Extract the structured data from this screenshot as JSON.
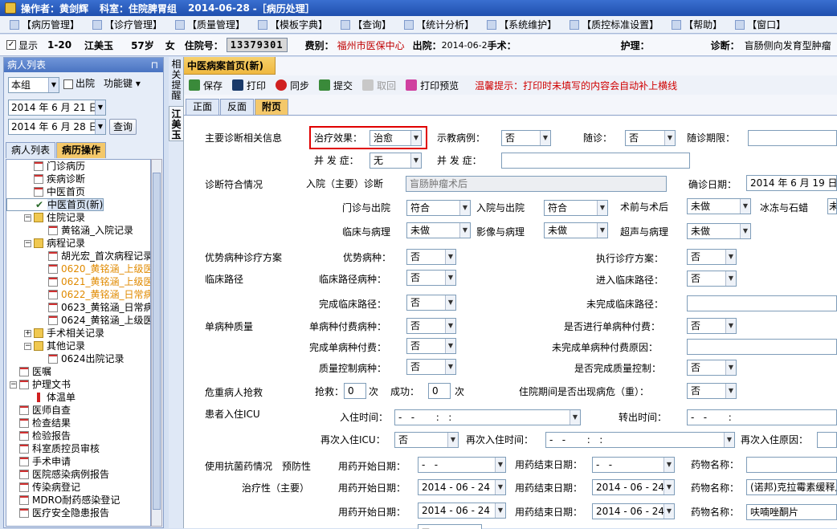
{
  "titlebar": {
    "operator_label": "操作者：黄剑辉",
    "dept_label": "科室：住院脾胃组",
    "date": "2014-06-28",
    "module": "-［病历处理］"
  },
  "menu": [
    "【病历管理】",
    "【诊疗管理】",
    "【质量管理】",
    "【模板字典】",
    "【查询】",
    "【统计分析】",
    "【系统维护】",
    "【质控标准设置】",
    "【帮助】",
    "【窗口】"
  ],
  "infobar": {
    "display_label": "显示",
    "range": "1-20",
    "patient_name": "江美玉",
    "age": "57岁",
    "sex": "女",
    "inpatient_label": "住院号：",
    "inpatient_no": "13379301",
    "fee_label": "费别：",
    "fee_value": "福州市医保中心",
    "discharge_label": "出院：",
    "discharge_value": "2014-06-2",
    "surgery_label": "手术：",
    "nursing_label": "护理：",
    "diagnosis_label": "诊断：",
    "diagnosis_value": "盲肠侧向发育型肿瘤"
  },
  "left": {
    "title": "病人列表",
    "pin": "⊓",
    "group": "本组",
    "discharged_label": "出院",
    "function_label": "功能键",
    "date_from": "2014 年 6 月 21 日",
    "date_to": "2014 年 6 月 28 日",
    "query_button": "查询",
    "tabs": [
      "病人列表",
      "病历操作"
    ],
    "tree": [
      {
        "label": "门诊病历",
        "level": 1,
        "icon": "doc"
      },
      {
        "label": "疾病诊断",
        "level": 1,
        "icon": "doc"
      },
      {
        "label": "中医首页",
        "level": 1,
        "icon": "doc"
      },
      {
        "label": "中医首页(新)",
        "level": 1,
        "icon": "check",
        "selected": true
      },
      {
        "label": "病历",
        "level": 0,
        "icon": "doc",
        "exp": "−"
      },
      {
        "label": "住院记录",
        "level": 1,
        "icon": "folder",
        "exp": "−"
      },
      {
        "label": "黄铭涵_入院记录",
        "level": 2,
        "icon": "doc"
      },
      {
        "label": "病程记录",
        "level": 1,
        "icon": "folder",
        "exp": "−"
      },
      {
        "label": "胡光宏_首次病程记录",
        "level": 2,
        "icon": "doc"
      },
      {
        "label": "0620_黄铭涵_上级医师查房",
        "level": 2,
        "icon": "doc",
        "orange": true
      },
      {
        "label": "0621_黄铭涵_上级医师查房",
        "level": 2,
        "icon": "doc",
        "orange": true
      },
      {
        "label": "0622_黄铭涵_日常病程",
        "level": 2,
        "icon": "doc",
        "orange": true
      },
      {
        "label": "0623_黄铭涵_日常病程",
        "level": 2,
        "icon": "doc"
      },
      {
        "label": "0624_黄铭涵_上级医师查房",
        "level": 2,
        "icon": "doc"
      },
      {
        "label": "手术相关记录",
        "level": 1,
        "icon": "folder",
        "exp": "+"
      },
      {
        "label": "其他记录",
        "level": 1,
        "icon": "folder",
        "exp": "−"
      },
      {
        "label": "0624出院记录",
        "level": 2,
        "icon": "doc"
      },
      {
        "label": "医嘱",
        "level": 0,
        "icon": "doc"
      },
      {
        "label": "护理文书",
        "level": 0,
        "icon": "doc",
        "exp": "−"
      },
      {
        "label": "体温单",
        "level": 1,
        "icon": "therm"
      },
      {
        "label": "医师自查",
        "level": 0,
        "icon": "doc"
      },
      {
        "label": "检查结果",
        "level": 0,
        "icon": "doc"
      },
      {
        "label": "检验报告",
        "level": 0,
        "icon": "doc"
      },
      {
        "label": "科室质控员审核",
        "level": 0,
        "icon": "doc"
      },
      {
        "label": "手术申请",
        "level": 0,
        "icon": "doc"
      },
      {
        "label": "医院感染病例报告",
        "level": 0,
        "icon": "doc"
      },
      {
        "label": "传染病登记",
        "level": 0,
        "icon": "doc"
      },
      {
        "label": "MDRO耐药感染登记",
        "level": 0,
        "icon": "doc"
      },
      {
        "label": "医疗安全隐患报告",
        "level": 0,
        "icon": "doc"
      }
    ]
  },
  "vstrip": {
    "top": "相关提醒",
    "patient": "江美玉"
  },
  "main": {
    "title": "中医病案首页(新)",
    "toolbar": {
      "save": "保存",
      "print": "打印",
      "sync": "同步",
      "submit": "提交",
      "withdraw": "取回",
      "preview": "打印预览",
      "warning": "温馨提示：打印时未填写的内容会自动补上横线"
    },
    "tabs": [
      "正面",
      "反面",
      "附页"
    ],
    "form": {
      "main_diag_info": "主要诊断相关信息",
      "effect_label": "治疗效果：",
      "effect_value": "治愈",
      "demo_case_label": "示教病例：",
      "demo_case_value": "否",
      "followup_label": "随诊：",
      "followup_value": "否",
      "followup_period_label": "随诊期限：",
      "complication_label": "并 发 症：",
      "complication_value": "无",
      "complication2_label": "并 发 症：",
      "diag_match": "诊断符合情况",
      "admission_diag_label": "入院（主要）诊断",
      "admission_diag_value": "盲肠肿瘤术后",
      "confirm_date_label": "确诊日期：",
      "confirm_date_value": "2014 年 6 月 19 日",
      "op_in_out_label": "门诊与出院",
      "op_in_out_value": "符合",
      "adm_out_label": "入院与出院",
      "adm_out_value": "符合",
      "pre_post_label": "术前与术后",
      "pre_post_value": "未做",
      "frozen_label": "冰冻与石蜡",
      "frozen_value": "未",
      "clin_path_label": "临床与病理",
      "clin_path_value": "未做",
      "img_path_label": "影像与病理",
      "img_path_value": "未做",
      "us_path_label": "超声与病理",
      "us_path_value": "未做",
      "adv_plan": "优势病种诊疗方案",
      "adv_disease_label": "优势病种：",
      "adv_disease_value": "否",
      "exec_plan_label": "执行诊疗方案：",
      "exec_plan_value": "否",
      "clinical_path": "临床路径",
      "cp_disease_label": "临床路径病种：",
      "cp_disease_value": "否",
      "enter_cp_label": "进入临床路径：",
      "enter_cp_value": "否",
      "complete_cp_label": "完成临床路径：",
      "complete_cp_value": "否",
      "incomplete_cp_label": "未完成临床路径：",
      "single_quality": "单病种质量",
      "single_pay_disease_label": "单病种付费病种：",
      "single_pay_disease_value": "否",
      "single_pay_label": "是否进行单病种付费：",
      "single_pay_value": "否",
      "complete_single_label": "完成单病种付费：",
      "complete_single_value": "否",
      "incomplete_single_label": "未完成单病种付费原因：",
      "qc_disease_label": "质量控制病种：",
      "qc_disease_value": "否",
      "complete_qc_label": "是否完成质量控制：",
      "complete_qc_value": "否",
      "rescue": "危重病人抢救",
      "rescue_count_label": "抢救：",
      "rescue_count": "0",
      "rescue_unit": "次",
      "success_label": "成功：",
      "success_count": "0",
      "success_unit": "次",
      "critical_label": "住院期间是否出现病危（重）：",
      "critical_value": "否",
      "icu": "患者入住ICU",
      "icu_in_label": "入住时间：",
      "icu_in_value": "-   -       :   :",
      "icu_out_label": "转出时间：",
      "icu_out_value": "-   -       :",
      "icu_re_label": "再次入住ICU：",
      "icu_re_value": "否",
      "icu_re_time_label": "再次入住时间：",
      "icu_re_time_value": "-   -       :   :",
      "icu_re_reason_label": "再次入住原因：",
      "antibiotic": "使用抗菌药情况",
      "prophylactic": "预防性",
      "therapeutic": "治疗性（主要）",
      "start_label": "用药开始日期：",
      "end_label": "用药结束日期：",
      "drug_label": "药物名称：",
      "rows": [
        {
          "start": "-   -",
          "end": "-   -",
          "drug": ""
        },
        {
          "start": "2014 - 06 - 24",
          "end": "2014 - 06 - 24",
          "drug": "(诺邦)克拉霉素缓释片"
        },
        {
          "start": "2014 - 06 - 24",
          "end": "2014 - 06 - 24",
          "drug": "呋喃唑酮片"
        }
      ],
      "last_value": "否"
    }
  }
}
